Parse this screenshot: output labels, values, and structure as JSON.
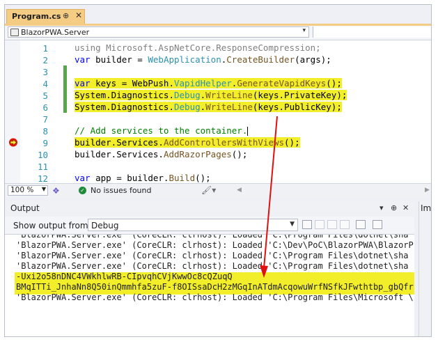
{
  "tab": {
    "title": "Program.cs",
    "pin": "⊕",
    "close": "✕"
  },
  "navbar": {
    "project": "BlazorPWA.Server",
    "dropdown": "▾"
  },
  "editor": {
    "lines": [
      {
        "num": "1",
        "segments": [
          {
            "c": "gr",
            "t": "using Microsoft.AspNetCore.ResponseCompression;"
          }
        ]
      },
      {
        "num": "2",
        "segments": [
          {
            "c": "kw",
            "t": "var"
          },
          {
            "c": "",
            "t": " builder = "
          },
          {
            "c": "ty",
            "t": "WebApplication"
          },
          {
            "c": "",
            "t": "."
          },
          {
            "c": "mt",
            "t": "CreateBuilder"
          },
          {
            "c": "",
            "t": "(args);"
          }
        ]
      },
      {
        "num": "3",
        "segments": []
      },
      {
        "num": "4",
        "highlight": true,
        "segments": [
          {
            "c": "kw",
            "t": "var"
          },
          {
            "c": "",
            "t": " keys = WebPush."
          },
          {
            "c": "ty",
            "t": "VapidHelper"
          },
          {
            "c": "",
            "t": "."
          },
          {
            "c": "mt",
            "t": "GenerateVapidKeys"
          },
          {
            "c": "",
            "t": "();"
          }
        ]
      },
      {
        "num": "5",
        "highlight": true,
        "segments": [
          {
            "c": "",
            "t": "System.Diagnostics."
          },
          {
            "c": "ty",
            "t": "Debug"
          },
          {
            "c": "",
            "t": "."
          },
          {
            "c": "mt",
            "t": "WriteLine"
          },
          {
            "c": "",
            "t": "(keys.PrivateKey);"
          }
        ]
      },
      {
        "num": "6",
        "highlight": true,
        "segments": [
          {
            "c": "",
            "t": "System.Diagnostics."
          },
          {
            "c": "ty",
            "t": "Debug"
          },
          {
            "c": "",
            "t": "."
          },
          {
            "c": "mt",
            "t": "WriteLine"
          },
          {
            "c": "",
            "t": "(keys.PublicKey);"
          }
        ]
      },
      {
        "num": "7",
        "segments": []
      },
      {
        "num": "8",
        "caret": true,
        "segments": [
          {
            "c": "cm",
            "t": "// Add services to the container."
          }
        ]
      },
      {
        "num": "9",
        "partial": true,
        "segments": [
          {
            "c": "",
            "t": "builder.Services."
          },
          {
            "c": "mt",
            "t": "AddControllersWithViews"
          },
          {
            "c": "",
            "t": "();"
          }
        ]
      },
      {
        "num": "10",
        "segments": [
          {
            "c": "",
            "t": "builder.Services."
          },
          {
            "c": "mt",
            "t": "AddRazorPages"
          },
          {
            "c": "",
            "t": "();"
          }
        ]
      },
      {
        "num": "11",
        "segments": []
      },
      {
        "num": "12",
        "segments": [
          {
            "c": "kw",
            "t": "var"
          },
          {
            "c": "",
            "t": " app = builder."
          },
          {
            "c": "mt",
            "t": "Build"
          },
          {
            "c": "",
            "t": "();"
          }
        ]
      }
    ]
  },
  "status": {
    "zoom": "100 %",
    "issues": "No issues found"
  },
  "output": {
    "title": "Output",
    "side_title": "Im",
    "show_from_label": "Show output from:",
    "source": "Debug",
    "lines": [
      "'BlazorPWA.Server.exe' (CoreCLR: clrhost): Loaded 'C:\\Program Files\\dotnet\\sha",
      "'BlazorPWA.Server.exe' (CoreCLR: clrhost): Loaded 'C:\\Dev\\PoC\\BlazorPWA\\BlazorP",
      "'BlazorPWA.Server.exe' (CoreCLR: clrhost): Loaded 'C:\\Program Files\\dotnet\\sha",
      "'BlazorPWA.Server.exe' (CoreCLR: clrhost): Loaded 'C:\\Program Files\\dotnet\\sha",
      "-Uxi2o58nDNC4VWkhlwRB-CIpvqhCVjKwwOc8cQZuqQ",
      "BMqITTi_JnhaNn8Q50inQmmhfa5zuF-f8OISsaDcH2zMGqInATdmAcqowuWrfNSfkJFwthtbp_gbQfr",
      "'BlazorPWA.Server.exe' (CoreCLR: clrhost): Loaded 'C:\\Program Files\\Microsoft \\"
    ]
  },
  "colors": {
    "highlight": "#f3ee2a",
    "tab": "#f5cc84",
    "arrow": "#e01010",
    "change_bar": "#57a64a"
  }
}
